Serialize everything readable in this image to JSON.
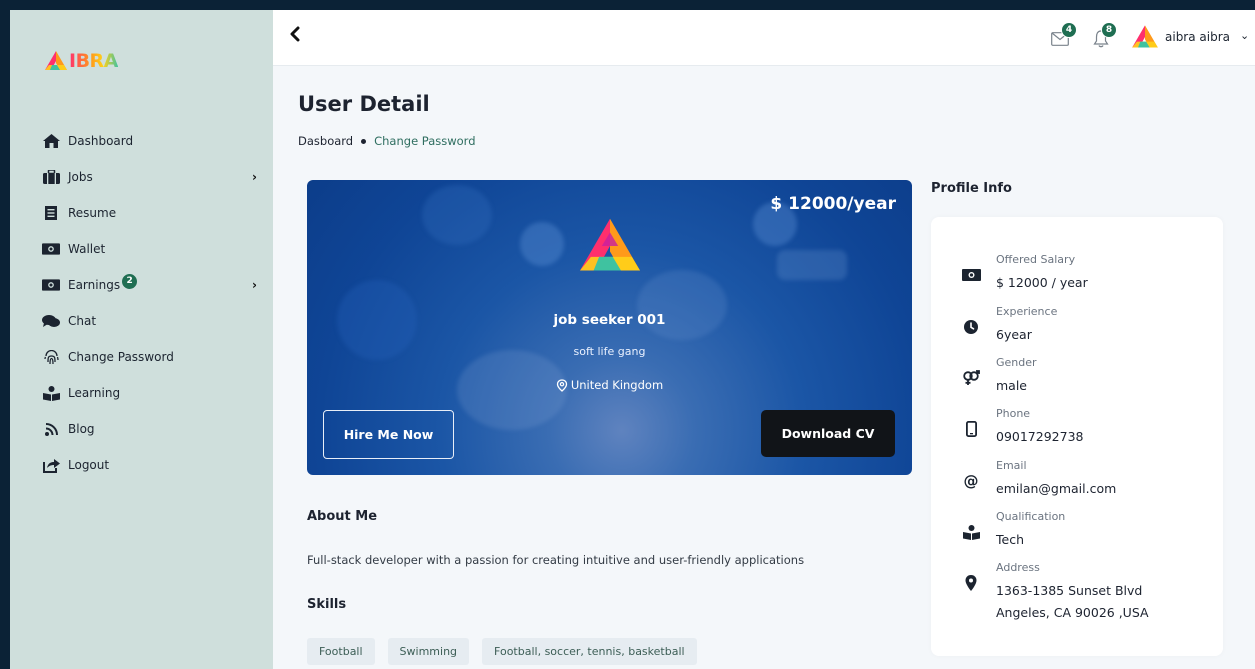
{
  "brand": {
    "name": "IBRA"
  },
  "sidebar": {
    "items": [
      {
        "label": "Dashboard"
      },
      {
        "label": "Jobs"
      },
      {
        "label": "Resume"
      },
      {
        "label": "Wallet"
      },
      {
        "label": "Earnings",
        "badge": "2"
      },
      {
        "label": "Chat"
      },
      {
        "label": "Change Password"
      },
      {
        "label": "Learning"
      },
      {
        "label": "Blog"
      },
      {
        "label": "Logout"
      }
    ]
  },
  "header": {
    "messages_count": "4",
    "notifications_count": "8",
    "user_name": "aibra aibra"
  },
  "page": {
    "title": "User Detail",
    "breadcrumb": [
      "Dasboard",
      "Change Password"
    ]
  },
  "hero": {
    "salary": "$ 12000/year",
    "name": "job seeker 001",
    "company": "soft life gang",
    "location": "United Kingdom",
    "hire_label": "Hire Me Now",
    "cv_label": "Download CV"
  },
  "about": {
    "title": "About Me",
    "text": "Full-stack developer with a passion for creating intuitive and user-friendly applications"
  },
  "skills": {
    "title": "Skills",
    "items": [
      "Football",
      "Swimming",
      "Football, soccer, tennis, basketball"
    ]
  },
  "profile": {
    "title": "Profile Info",
    "rows": [
      {
        "label": "Offered Salary",
        "value": "$ 12000 / year",
        "icon": "money-icon"
      },
      {
        "label": "Experience",
        "value": "6year",
        "icon": "clock-icon"
      },
      {
        "label": "Gender",
        "value": "male",
        "icon": "gender-icon"
      },
      {
        "label": "Phone",
        "value": "09017292738",
        "icon": "phone-icon"
      },
      {
        "label": "Email",
        "value": "emilan@gmail.com",
        "icon": "at-icon"
      },
      {
        "label": "Qualification",
        "value": "Tech",
        "icon": "reader-icon"
      },
      {
        "label": "Address",
        "value": "1363-1385 Sunset Blvd",
        "value2": "Angeles, CA 90026 ,USA",
        "icon": "map-pin-icon"
      }
    ]
  },
  "colors": {
    "accent": "#1f6e52",
    "hero": "#1b56a6",
    "sidebar": "#cfdfdc"
  }
}
